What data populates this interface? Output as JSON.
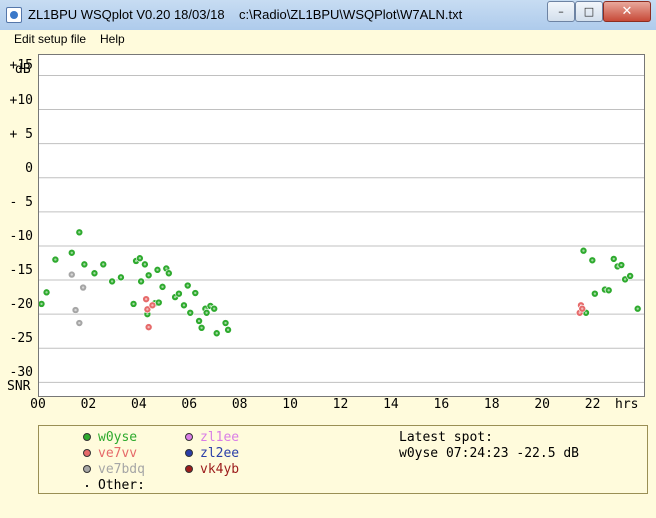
{
  "window": {
    "title": "ZL1BPU WSQplot V0.20 18/03/18    c:\\Radio\\ZL1BPU\\WSQPlot\\W7ALN.txt",
    "min_glyph": "–",
    "max_glyph": "□",
    "close_glyph": "✕"
  },
  "menu": {
    "items": [
      {
        "label": "Edit setup file"
      },
      {
        "label": "Help"
      }
    ]
  },
  "plot": {
    "bg": "#ffffff",
    "grid_color": "#c0c0c0"
  },
  "chart_data": {
    "type": "scatter",
    "xlim": [
      0,
      24
    ],
    "ylim": [
      -32,
      18
    ],
    "y_unit_label": "dB",
    "y_bottom_label": "SNR",
    "x_unit_label": "hrs",
    "y_ticks": [
      {
        "value": 15,
        "label": "+15"
      },
      {
        "value": 10,
        "label": "+10"
      },
      {
        "value": 5,
        "label": "+ 5"
      },
      {
        "value": 0,
        "label": "0"
      },
      {
        "value": -5,
        "label": "- 5"
      },
      {
        "value": -10,
        "label": "-10"
      },
      {
        "value": -15,
        "label": "-15"
      },
      {
        "value": -20,
        "label": "-20"
      },
      {
        "value": -25,
        "label": "-25"
      },
      {
        "value": -30,
        "label": "-30"
      }
    ],
    "x_ticks": [
      {
        "value": 0,
        "label": "00"
      },
      {
        "value": 2,
        "label": "02"
      },
      {
        "value": 4,
        "label": "04"
      },
      {
        "value": 6,
        "label": "06"
      },
      {
        "value": 8,
        "label": "08"
      },
      {
        "value": 10,
        "label": "10"
      },
      {
        "value": 12,
        "label": "12"
      },
      {
        "value": 14,
        "label": "14"
      },
      {
        "value": 16,
        "label": "16"
      },
      {
        "value": 18,
        "label": "18"
      },
      {
        "value": 20,
        "label": "20"
      },
      {
        "value": 22,
        "label": "22"
      }
    ],
    "grid": true,
    "series": [
      {
        "name": "w0yse",
        "color": "#2eaa2e",
        "points": [
          [
            0.1,
            -18.5
          ],
          [
            0.3,
            -16.8
          ],
          [
            0.65,
            -12.0
          ],
          [
            1.3,
            -11.0
          ],
          [
            1.6,
            -8.0
          ],
          [
            1.8,
            -12.7
          ],
          [
            2.2,
            -14.0
          ],
          [
            2.55,
            -12.7
          ],
          [
            2.9,
            -15.2
          ],
          [
            3.25,
            -14.6
          ],
          [
            3.75,
            -18.5
          ],
          [
            3.85,
            -12.2
          ],
          [
            4.0,
            -11.8
          ],
          [
            4.05,
            -15.2
          ],
          [
            4.2,
            -12.7
          ],
          [
            4.3,
            -20.0
          ],
          [
            4.35,
            -14.3
          ],
          [
            4.6,
            -18.4
          ],
          [
            4.7,
            -13.5
          ],
          [
            4.75,
            -18.3
          ],
          [
            4.9,
            -16.0
          ],
          [
            5.05,
            -13.3
          ],
          [
            5.15,
            -14.0
          ],
          [
            5.4,
            -17.5
          ],
          [
            5.55,
            -17.0
          ],
          [
            5.75,
            -18.7
          ],
          [
            5.9,
            -15.8
          ],
          [
            6.0,
            -19.8
          ],
          [
            6.2,
            -16.9
          ],
          [
            6.35,
            -21.0
          ],
          [
            6.45,
            -22.0
          ],
          [
            6.6,
            -19.2
          ],
          [
            6.65,
            -19.8
          ],
          [
            6.8,
            -18.8
          ],
          [
            6.95,
            -19.2
          ],
          [
            7.05,
            -22.8
          ],
          [
            7.4,
            -21.3
          ],
          [
            7.5,
            -22.3
          ],
          [
            21.6,
            -10.7
          ],
          [
            21.7,
            -19.8
          ],
          [
            21.95,
            -12.1
          ],
          [
            22.05,
            -17.0
          ],
          [
            22.45,
            -16.4
          ],
          [
            22.6,
            -16.5
          ],
          [
            22.8,
            -11.9
          ],
          [
            22.95,
            -13.0
          ],
          [
            23.1,
            -12.8
          ],
          [
            23.25,
            -14.9
          ],
          [
            23.45,
            -14.4
          ],
          [
            23.75,
            -19.2
          ]
        ]
      },
      {
        "name": "ve7vv",
        "color": "#e66a6a",
        "points": [
          [
            4.25,
            -17.8
          ],
          [
            4.3,
            -19.3
          ],
          [
            4.35,
            -21.9
          ],
          [
            4.5,
            -18.7
          ],
          [
            21.45,
            -19.8
          ],
          [
            21.5,
            -18.7
          ],
          [
            21.55,
            -19.2
          ]
        ]
      },
      {
        "name": "ve7bdq",
        "color": "#a6a6a6",
        "points": [
          [
            1.3,
            -14.2
          ],
          [
            1.45,
            -19.4
          ],
          [
            1.6,
            -21.3
          ],
          [
            1.75,
            -16.1
          ]
        ]
      },
      {
        "name": "zl1ee",
        "color": "#d97ee6",
        "points": []
      },
      {
        "name": "zl2ee",
        "color": "#2a3ea8",
        "points": []
      },
      {
        "name": "vk4yb",
        "color": "#9c1c1c",
        "points": []
      }
    ]
  },
  "legend": {
    "entries": [
      {
        "label": "w0yse",
        "color": "#2eaa2e"
      },
      {
        "label": "ve7vv",
        "color": "#e66a6a"
      },
      {
        "label": "ve7bdq",
        "color": "#a6a6a6"
      },
      {
        "label": "zl1ee",
        "color": "#d97ee6"
      },
      {
        "label": "zl2ee",
        "color": "#2a3ea8"
      },
      {
        "label": "vk4yb",
        "color": "#9c1c1c"
      }
    ],
    "other_label": "Other:",
    "latest_title": "Latest spot:",
    "latest_value": "w0yse 07:24:23 -22.5 dB"
  }
}
